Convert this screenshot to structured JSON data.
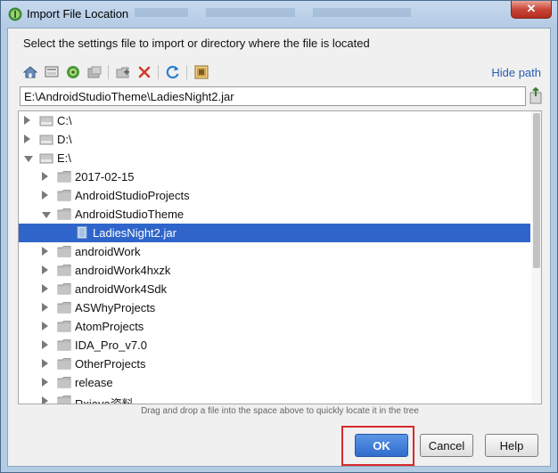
{
  "window": {
    "title": "Import File Location",
    "close_label": "✕"
  },
  "dialog": {
    "prompt": "Select the settings file to import or directory where the file is located",
    "hide_path_label": "Hide path",
    "path_value": "E:\\AndroidStudioTheme\\LadiesNight2.jar",
    "hint": "Drag and drop a file into the space above to quickly locate it in the tree"
  },
  "toolbar": {
    "icons": [
      "home-icon",
      "desktop-icon",
      "android-project-icon",
      "module-icon",
      "new-folder-icon",
      "delete-icon",
      "refresh-icon",
      "show-hidden-icon"
    ]
  },
  "tree": {
    "items": [
      {
        "label": "C:\\",
        "depth": 0,
        "arrow": "right",
        "kind": "drive"
      },
      {
        "label": "D:\\",
        "depth": 0,
        "arrow": "right",
        "kind": "drive"
      },
      {
        "label": "E:\\",
        "depth": 0,
        "arrow": "down",
        "kind": "drive"
      },
      {
        "label": "2017-02-15",
        "depth": 1,
        "arrow": "right",
        "kind": "folder"
      },
      {
        "label": "AndroidStudioProjects",
        "depth": 1,
        "arrow": "right",
        "kind": "folder"
      },
      {
        "label": "AndroidStudioTheme",
        "depth": 1,
        "arrow": "down",
        "kind": "folder"
      },
      {
        "label": "LadiesNight2.jar",
        "depth": 2,
        "arrow": "none",
        "kind": "jar",
        "selected": true
      },
      {
        "label": "androidWork",
        "depth": 1,
        "arrow": "right",
        "kind": "folder"
      },
      {
        "label": "androidWork4hxzk",
        "depth": 1,
        "arrow": "right",
        "kind": "folder"
      },
      {
        "label": "androidWork4Sdk",
        "depth": 1,
        "arrow": "right",
        "kind": "folder"
      },
      {
        "label": "ASWhyProjects",
        "depth": 1,
        "arrow": "right",
        "kind": "folder"
      },
      {
        "label": "AtomProjects",
        "depth": 1,
        "arrow": "right",
        "kind": "folder"
      },
      {
        "label": "IDA_Pro_v7.0",
        "depth": 1,
        "arrow": "right",
        "kind": "folder"
      },
      {
        "label": "OtherProjects",
        "depth": 1,
        "arrow": "right",
        "kind": "folder"
      },
      {
        "label": "release",
        "depth": 1,
        "arrow": "right",
        "kind": "folder"
      },
      {
        "label": "Rxjava资料",
        "depth": 1,
        "arrow": "right",
        "kind": "folder"
      }
    ]
  },
  "buttons": {
    "ok": "OK",
    "cancel": "Cancel",
    "help": "Help"
  },
  "colors": {
    "selection": "#2f65ca",
    "link": "#2a5db0",
    "ok_button": "#2f6ccd",
    "highlight_box": "#d62b2b"
  }
}
